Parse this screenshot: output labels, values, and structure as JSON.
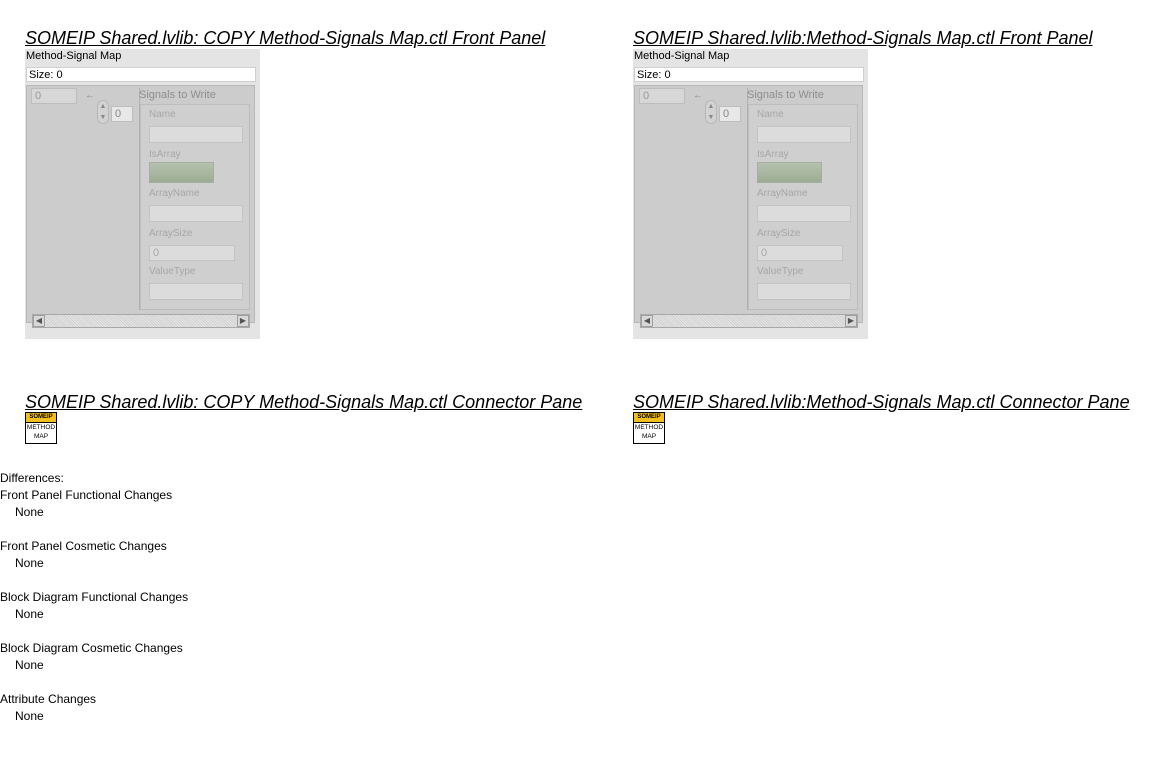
{
  "left": {
    "front_panel_title": "SOMEIP Shared.lvlib:  COPY  Method-Signals Map.ctl Front Panel",
    "connector_pane_title": "SOMEIP Shared.lvlib:  COPY  Method-Signals Map.ctl Connector Pane"
  },
  "right": {
    "front_panel_title": "SOMEIP Shared.lvlib:Method-Signals Map.ctl Front Panel",
    "connector_pane_title": "SOMEIP Shared.lvlib:Method-Signals Map.ctl Connector Pane"
  },
  "front_panel": {
    "control_label": "Method-Signal Map",
    "size_label": "Size: 0",
    "outer_index": "0",
    "inner_index": "0",
    "cluster_title": "Signals to Write",
    "fields": {
      "name": "Name",
      "is_array": "IsArray",
      "array_name": "ArrayName",
      "array_size": "ArraySize",
      "array_size_value": "0",
      "value_type": "ValueType"
    }
  },
  "connector_icon": {
    "top": "SOMEIP",
    "line1": "METHOD",
    "line2": "MAP",
    "top_color": "#f2c01e"
  },
  "differences": {
    "heading": "Differences:",
    "groups": [
      {
        "label": "Front Panel Functional Changes",
        "value": "None"
      },
      {
        "label": "Front Panel Cosmetic Changes",
        "value": "None"
      },
      {
        "label": "Block Diagram Functional Changes",
        "value": "None"
      },
      {
        "label": "Block Diagram Cosmetic Changes",
        "value": "None"
      },
      {
        "label": "Attribute Changes",
        "value": "None"
      }
    ]
  }
}
